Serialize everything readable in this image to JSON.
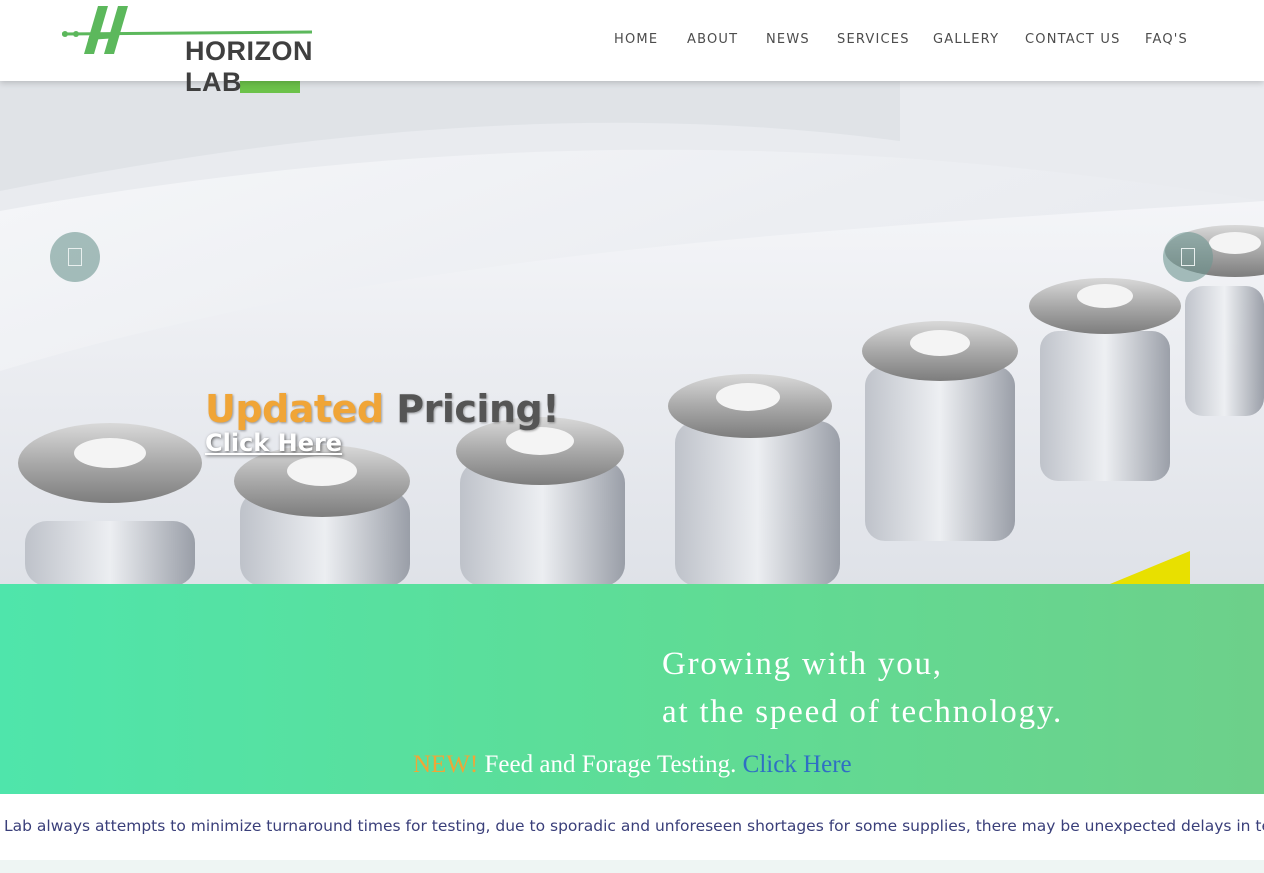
{
  "brand": {
    "name": "HORIZON LAB",
    "logo_color": "#5cb85c"
  },
  "nav": {
    "items": [
      {
        "label": "HOME"
      },
      {
        "label": "ABOUT"
      },
      {
        "label": "NEWS"
      },
      {
        "label": "SERVICES"
      },
      {
        "label": "GALLERY"
      },
      {
        "label": "CONTACT US"
      },
      {
        "label": "FAQ'S"
      }
    ]
  },
  "hero": {
    "title_accent": "Updated",
    "title_rest": " Pricing!",
    "link": "Click Here",
    "prev_icon": "chevron-left-icon",
    "next_icon": "chevron-right-icon"
  },
  "banner": {
    "tagline_1": "Growing with you,",
    "tagline_2": "at the speed of technology.",
    "news_badge": "NEW!",
    "news_text": " Feed and Forage Testing. ",
    "news_link": "Click Here"
  },
  "ticker": {
    "text": "Lab always attempts to minimize turnaround times for testing, due to sporadic and unforeseen shortages for some supplies, there may be unexpected delays in testing o"
  },
  "colors": {
    "accent_orange": "#f0a537",
    "banner_green": "#5fdc95",
    "link_blue": "#2f6fc4",
    "ticker_text": "#3a3f7a"
  }
}
